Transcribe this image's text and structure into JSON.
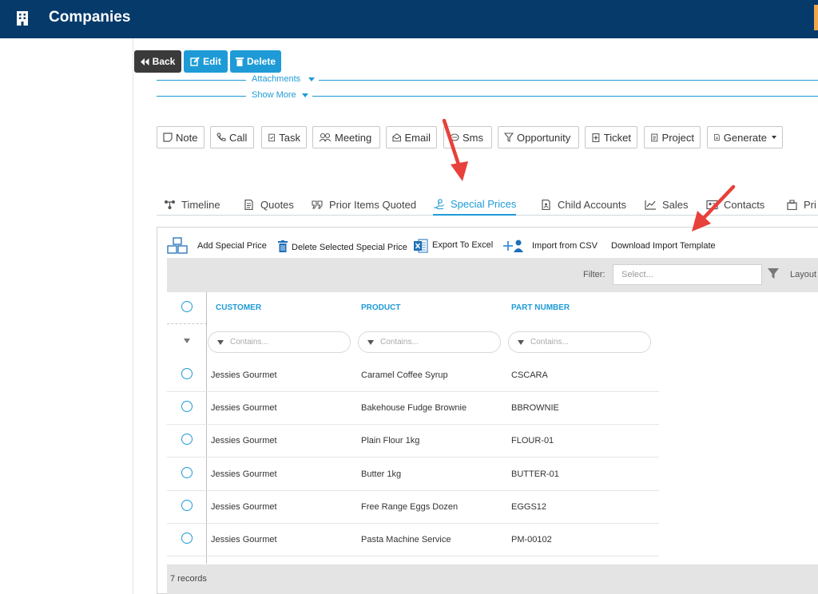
{
  "header": {
    "title": "Companies",
    "icon": "building-icon"
  },
  "toolbar": {
    "back_label": "Back",
    "edit_label": "Edit",
    "delete_label": "Delete"
  },
  "sections": {
    "attachments_label": "Attachments",
    "show_more_label": "Show More"
  },
  "actions": [
    {
      "label": "Note",
      "icon": "note-icon"
    },
    {
      "label": "Call",
      "icon": "phone-icon"
    },
    {
      "label": "Task",
      "icon": "task-icon"
    },
    {
      "label": "Meeting",
      "icon": "people-icon"
    },
    {
      "label": "Email",
      "icon": "email-icon"
    },
    {
      "label": "Sms",
      "icon": "sms-icon"
    },
    {
      "label": "Opportunity",
      "icon": "funnel-icon"
    },
    {
      "label": "Ticket",
      "icon": "ticket-icon"
    },
    {
      "label": "Project",
      "icon": "project-icon"
    },
    {
      "label": "Generate",
      "icon": "document-icon"
    }
  ],
  "tabs": [
    {
      "label": "Timeline",
      "icon": "timeline-icon"
    },
    {
      "label": "Quotes",
      "icon": "quote-doc-icon"
    },
    {
      "label": "Prior Items Quoted",
      "icon": "quote-marks-icon"
    },
    {
      "label": "Special Prices",
      "icon": "hand-coin-icon",
      "active": true
    },
    {
      "label": "Child Accounts",
      "icon": "child-doc-icon"
    },
    {
      "label": "Sales",
      "icon": "line-chart-icon"
    },
    {
      "label": "Contacts",
      "icon": "contact-card-icon"
    },
    {
      "label": "Pri",
      "icon": "building-small-icon"
    }
  ],
  "special_prices": {
    "tools": {
      "add": "Add Special Price",
      "delete": "Delete Selected Special Price",
      "export": "Export To Excel",
      "import": "Import from CSV",
      "template": "Download Import Template"
    },
    "filter_label": "Filter:",
    "filter_placeholder": "Select...",
    "layout_label": "Layout",
    "columns": [
      "CUSTOMER",
      "PRODUCT",
      "PART NUMBER"
    ],
    "column_filter_placeholder": "Contains...",
    "rows": [
      {
        "customer": "Jessies Gourmet",
        "product": "Caramel Coffee Syrup",
        "part": "CSCARA"
      },
      {
        "customer": "Jessies Gourmet",
        "product": "Bakehouse Fudge Brownie",
        "part": "BBROWNIE"
      },
      {
        "customer": "Jessies Gourmet",
        "product": "Plain Flour 1kg",
        "part": "FLOUR-01"
      },
      {
        "customer": "Jessies Gourmet",
        "product": "Butter 1kg",
        "part": "BUTTER-01"
      },
      {
        "customer": "Jessies Gourmet",
        "product": "Free Range Eggs Dozen",
        "part": "EGGS12"
      },
      {
        "customer": "Jessies Gourmet",
        "product": "Pasta Machine Service",
        "part": "PM-00102"
      }
    ],
    "records_label": "7 records"
  },
  "colors": {
    "header_bg": "#053a6b",
    "accent": "#1e9bd7",
    "annotation_arrow": "#e8403a"
  }
}
